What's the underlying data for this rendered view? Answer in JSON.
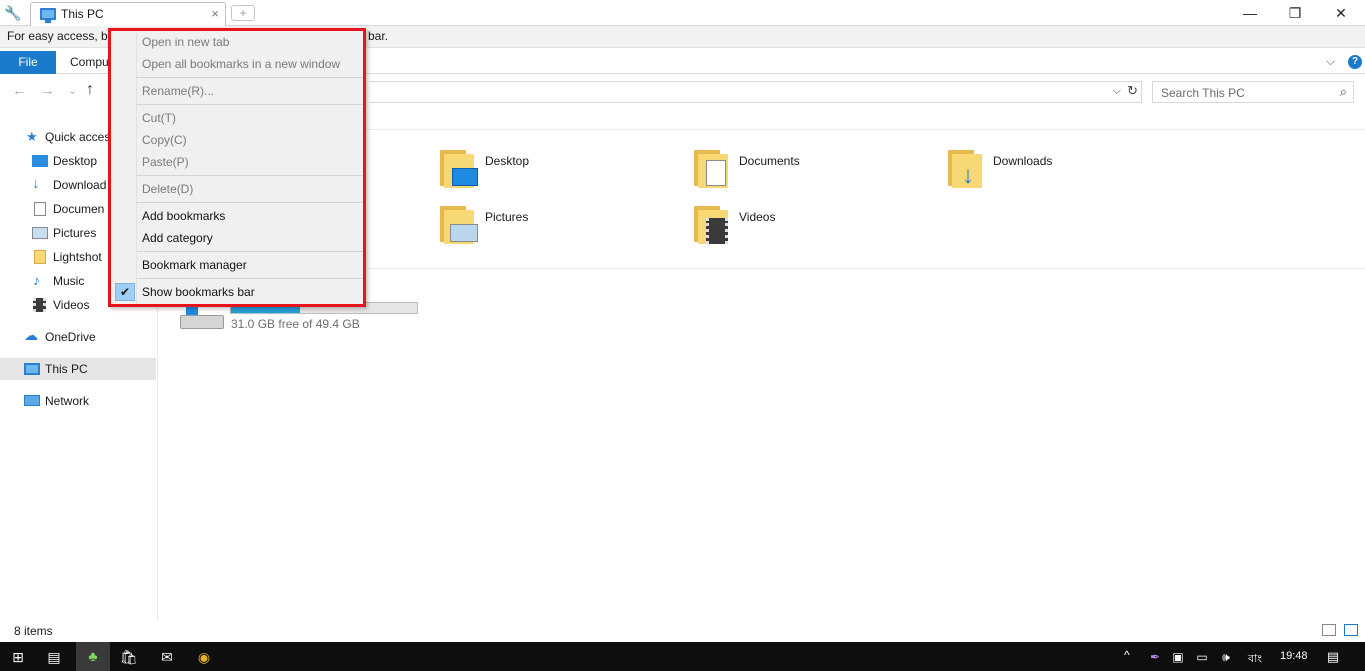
{
  "window": {
    "tab_title": "This PC",
    "tab_close": "×",
    "new_tab": "+",
    "minimize": "—",
    "restore": "❐",
    "close": "✕"
  },
  "infobar": {
    "text_left": "For easy access, bo",
    "text_right": "bar."
  },
  "ribbon": {
    "file": "File",
    "computer": "Compu",
    "chevron": "⌵",
    "help": "?"
  },
  "nav": {
    "back": "←",
    "forward": "→",
    "recent": "⌄",
    "up": "↑",
    "address_chevron": "⌵",
    "refresh": "↻",
    "search_placeholder": "Search This PC",
    "search_icon": "⌕"
  },
  "sidebar": {
    "items": [
      {
        "label": "Quick acces",
        "icon": "star-icon"
      },
      {
        "label": "Desktop",
        "icon": "desktop-icon"
      },
      {
        "label": "Download",
        "icon": "download-icon"
      },
      {
        "label": "Documen",
        "icon": "document-icon"
      },
      {
        "label": "Pictures",
        "icon": "pictures-icon"
      },
      {
        "label": "Lightshot",
        "icon": "folder-icon"
      },
      {
        "label": "Music",
        "icon": "music-icon"
      },
      {
        "label": "Videos",
        "icon": "videos-icon"
      },
      {
        "label": "OneDrive",
        "icon": "cloud-icon"
      },
      {
        "label": "This PC",
        "icon": "computer-icon"
      },
      {
        "label": "Network",
        "icon": "network-icon"
      }
    ]
  },
  "folders": [
    {
      "label": "Desktop"
    },
    {
      "label": "Documents"
    },
    {
      "label": "Downloads"
    },
    {
      "label": "Pictures"
    },
    {
      "label": "Videos"
    }
  ],
  "drive": {
    "free_text": "31.0 GB free of 49.4 GB",
    "used_fraction": 0.37
  },
  "status": {
    "items_count": "8 items"
  },
  "context_menu": {
    "items": [
      {
        "label": "Open in new tab",
        "enabled": false
      },
      {
        "label": "Open all bookmarks in a new window",
        "enabled": false
      },
      {
        "label": "Rename(R)...",
        "enabled": false
      },
      {
        "label": "Cut(T)",
        "enabled": false
      },
      {
        "label": "Copy(C)",
        "enabled": false
      },
      {
        "label": "Paste(P)",
        "enabled": false
      },
      {
        "label": "Delete(D)",
        "enabled": false
      },
      {
        "label": "Add bookmarks",
        "enabled": true
      },
      {
        "label": "Add category",
        "enabled": true
      },
      {
        "label": "Bookmark manager",
        "enabled": true
      },
      {
        "label": "Show bookmarks bar",
        "enabled": true,
        "checked": true
      }
    ],
    "check_mark": "✔"
  },
  "taskbar": {
    "tray_chevron": "^",
    "language": "বাং",
    "time": "19:48"
  }
}
